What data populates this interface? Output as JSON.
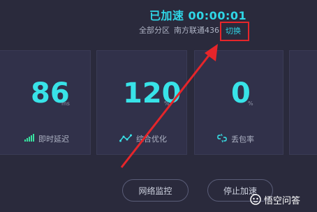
{
  "status": {
    "label": "已加速",
    "timer": "00:00:01"
  },
  "region": {
    "scope": "全部分区",
    "server": "南方联通436",
    "switch_label": "切换"
  },
  "metrics": [
    {
      "value": "86",
      "unit": "ms",
      "label": "即时延迟",
      "icon": "signal-bars-icon"
    },
    {
      "value": "120",
      "unit": "%",
      "label": "综合优化",
      "icon": "trend-line-icon"
    },
    {
      "value": "0",
      "unit": "%",
      "label": "丢包率",
      "icon": "broken-link-icon"
    }
  ],
  "buttons": {
    "monitor": "网络监控",
    "stop": "停止加速"
  },
  "watermark": {
    "text": "悟空问答"
  },
  "colors": {
    "accent": "#2fd6e6",
    "highlight": "#e6252a",
    "background": "#2a2a3c"
  }
}
